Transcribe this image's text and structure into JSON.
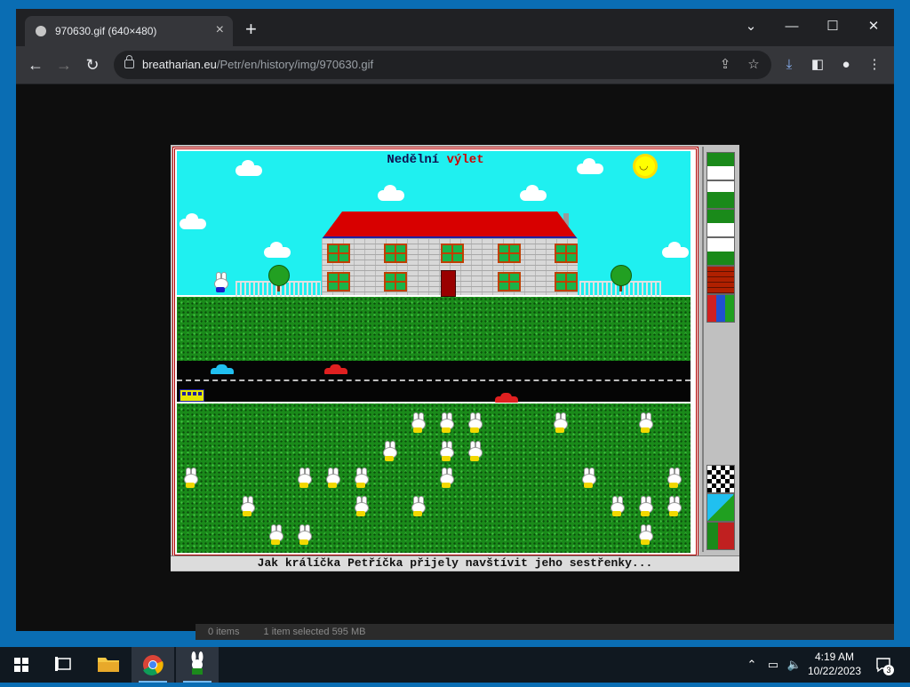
{
  "browser": {
    "tab_title": "970630.gif (640×480)",
    "url_host": "breatharian.eu",
    "url_path": "/Petr/en/history/img/970630.gif",
    "new_tab": "+",
    "tab_close": "×"
  },
  "game": {
    "title_part1": "Nedělní ",
    "title_part2": "výlet",
    "caption": "Jak králíčka Petříčka přijely navštívit jeho sestřenky..."
  },
  "explorer": {
    "status_items": "0 items",
    "status_selected": "1 item selected  595 MB"
  },
  "taskbar": {
    "time": "4:19 AM",
    "date": "10/22/2023",
    "notifications": "3"
  },
  "icons": [
    "back-icon",
    "forward-icon",
    "reload-icon",
    "lock-icon",
    "share-icon",
    "star-icon",
    "download-icon",
    "sidepanel-icon",
    "profile-icon",
    "menu-icon",
    "windows-start-icon",
    "task-view-icon",
    "file-explorer-icon",
    "chrome-icon",
    "bunny-app-icon",
    "chevron-up-icon",
    "network-icon",
    "volume-muted-icon",
    "notification-icon"
  ],
  "colors": {
    "sky": "#1ff0f0",
    "grass": "#1a8a1a",
    "roof": "#d80000",
    "title_accent": "#d00000",
    "taskbar": "#101820"
  }
}
